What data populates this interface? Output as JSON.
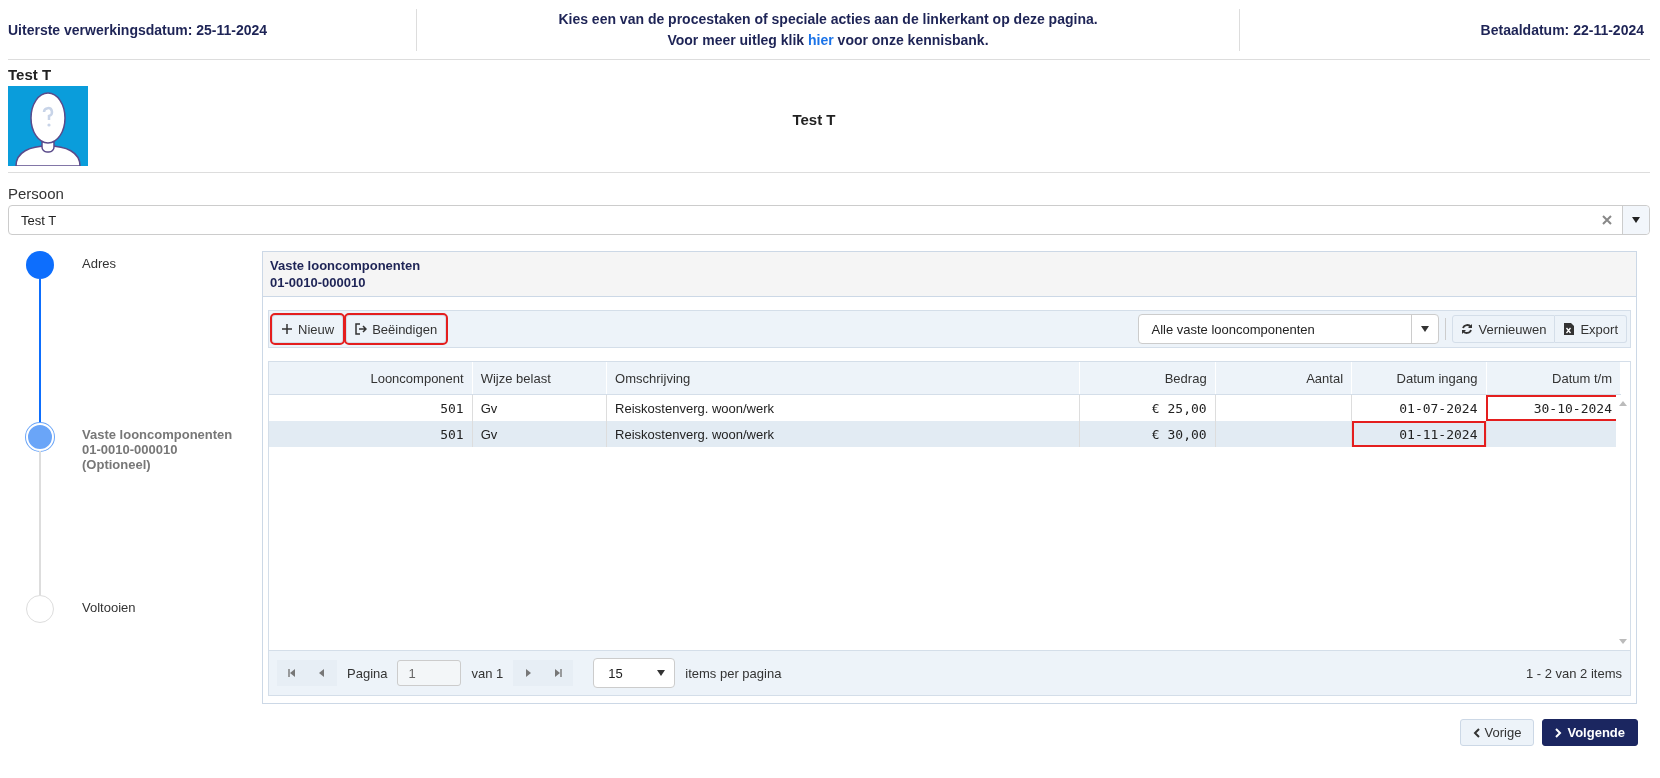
{
  "header": {
    "left": "Uiterste verwerkingsdatum: 25-11-2024",
    "center_line_1": "Kies een van de procestaken of speciale acties aan de linkerkant op deze pagina.",
    "center_line_2_before": "Voor meer uitleg klik",
    "center_link": "hier",
    "center_line_2_after": "voor onze kennisbank.",
    "right": "Betaaldatum: 22-11-2024"
  },
  "person": {
    "name": "Test T",
    "title": "Test T"
  },
  "persoon_field": {
    "label": "Persoon",
    "value": "Test T"
  },
  "steps": [
    {
      "lines": [
        "Adres"
      ],
      "kind": "done"
    },
    {
      "lines": [
        "Vaste looncomponenten",
        "01-0010-000010",
        "(Optioneel)"
      ],
      "kind": "current"
    },
    {
      "lines": [
        "Voltooien"
      ],
      "kind": "pending"
    }
  ],
  "panel": {
    "title": "Vaste looncomponenten",
    "subtitle": "01-0010-000010",
    "toolbar_left": [
      {
        "label": "Nieuw",
        "highlighted": true
      },
      {
        "label": "Beëindigen",
        "highlighted": true
      }
    ],
    "filter": {
      "value": "Alle vaste looncomponenten"
    },
    "toolbar_right": [
      {
        "label": "Vernieuwen"
      },
      {
        "label": "Export"
      }
    ],
    "table": {
      "columns": [
        {
          "label": "Looncomponent"
        },
        {
          "label": "Wijze belast"
        },
        {
          "label": "Omschrijving"
        },
        {
          "label": "Bedrag"
        },
        {
          "label": "Aantal"
        },
        {
          "label": "Datum ingang"
        },
        {
          "label": "Datum t/m"
        }
      ],
      "rows": [
        {
          "selected": false,
          "cells": [
            {
              "text": "501",
              "highlighted": false
            },
            {
              "text": "Gv",
              "highlighted": false
            },
            {
              "text": "Reiskostenverg. woon/werk",
              "highlighted": false
            },
            {
              "text": "€ 25,00",
              "highlighted": false
            },
            {
              "highlighted": false
            },
            {
              "text": "01-07-2024",
              "highlighted": false
            },
            {
              "text": "30-10-2024",
              "highlighted": true
            }
          ]
        },
        {
          "selected": true,
          "cells": [
            {
              "text": "501",
              "highlighted": false
            },
            {
              "text": "Gv",
              "highlighted": false
            },
            {
              "text": "Reiskostenverg. woon/werk",
              "highlighted": false
            },
            {
              "text": "€ 30,00",
              "highlighted": false
            },
            {
              "highlighted": false
            },
            {
              "text": "01-11-2024",
              "highlighted": true
            },
            {
              "highlighted": false
            }
          ]
        }
      ]
    },
    "pager": {
      "page_label": "Pagina",
      "page": "1",
      "of": "van 1",
      "page_size": "15",
      "per_page": "items per pagina",
      "summary": "1 - 2 van 2 items"
    }
  },
  "buttons": [
    {
      "label": "Vorige",
      "kind": "secondary"
    },
    {
      "label": "Volgende",
      "kind": "primary"
    }
  ]
}
